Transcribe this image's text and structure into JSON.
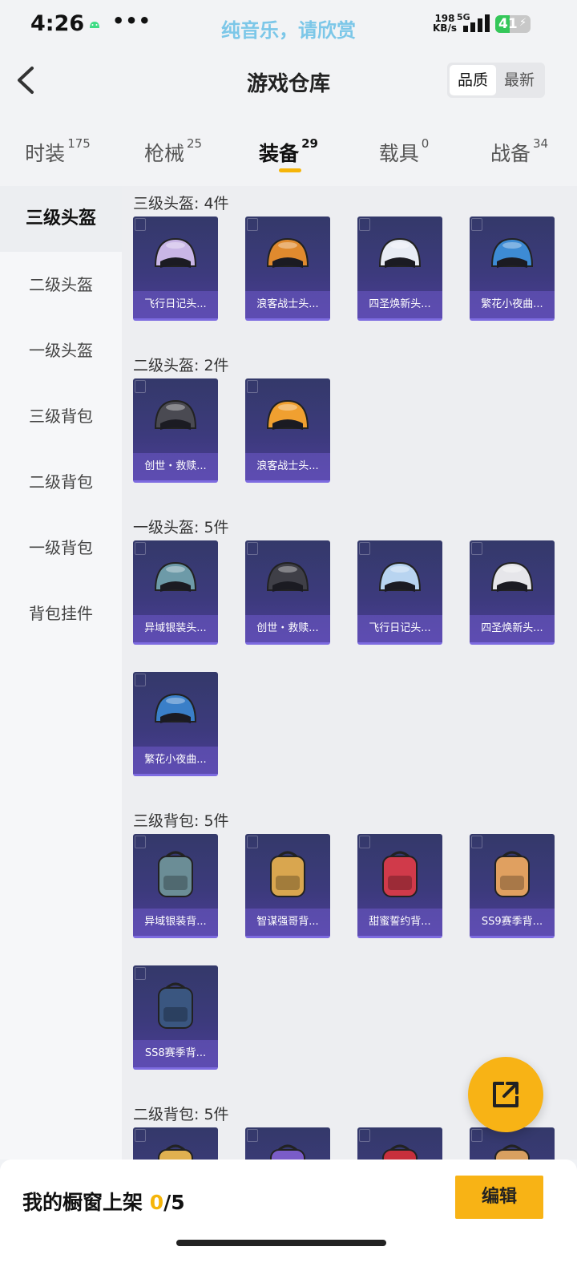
{
  "status_bar": {
    "time": "4:26",
    "marquee": "纯音乐，请欣赏",
    "net_speed_value": "198",
    "net_speed_unit": "KB/s",
    "network": "5G",
    "battery": "41",
    "battery_level": 0.41
  },
  "header": {
    "title": "游戏仓库",
    "sort_options": [
      "品质",
      "最新"
    ],
    "sort_selected": "品质"
  },
  "tabs": [
    {
      "label": "时装",
      "count": "175"
    },
    {
      "label": "枪械",
      "count": "25"
    },
    {
      "label": "装备",
      "count": "29",
      "active": true
    },
    {
      "label": "载具",
      "count": "0"
    },
    {
      "label": "战备",
      "count": "34"
    }
  ],
  "sidebar": {
    "items": [
      "三级头盔",
      "二级头盔",
      "一级头盔",
      "三级背包",
      "二级背包",
      "一级背包",
      "背包挂件"
    ],
    "active": "三级头盔"
  },
  "groups": [
    {
      "title": "三级头盔: 4件",
      "items": [
        {
          "name": "飞行日记头...",
          "icon": "helmet-icon",
          "color": "#c9b6e6"
        },
        {
          "name": "浪客战士头...",
          "icon": "helmet-icon",
          "color": "#e08a2e"
        },
        {
          "name": "四圣焕新头...",
          "icon": "helmet-icon",
          "color": "#e8ecf4"
        },
        {
          "name": "繁花小夜曲...",
          "icon": "helmet-icon",
          "color": "#3d8bd4"
        }
      ]
    },
    {
      "title": "二级头盔: 2件",
      "items": [
        {
          "name": "创世・救赎...",
          "icon": "helmet-icon",
          "color": "#4a4a52"
        },
        {
          "name": "浪客战士头...",
          "icon": "helmet-icon",
          "color": "#f0a030"
        }
      ]
    },
    {
      "title": "一级头盔: 5件",
      "items": [
        {
          "name": "异域银装头...",
          "icon": "helmet-icon",
          "color": "#6d9aa8"
        },
        {
          "name": "创世・救赎...",
          "icon": "helmet-icon",
          "color": "#3f3f47"
        },
        {
          "name": "飞行日记头...",
          "icon": "helmet-icon",
          "color": "#b8d4f0"
        },
        {
          "name": "四圣焕新头...",
          "icon": "helmet-icon",
          "color": "#e6e6ea"
        },
        {
          "name": "繁花小夜曲...",
          "icon": "helmet-icon",
          "color": "#3a7fc8"
        }
      ]
    },
    {
      "title": "三级背包: 5件",
      "items": [
        {
          "name": "异域银装背...",
          "icon": "backpack-icon",
          "color": "#6b8d96"
        },
        {
          "name": "智谋强哥背...",
          "icon": "backpack-icon",
          "color": "#d9a64f"
        },
        {
          "name": "甜蜜誓约背...",
          "icon": "backpack-icon",
          "color": "#d03a4a"
        },
        {
          "name": "SS9赛季背...",
          "icon": "backpack-icon",
          "color": "#e0a060"
        },
        {
          "name": "SS8赛季背...",
          "icon": "backpack-icon",
          "color": "#3a5680"
        }
      ]
    },
    {
      "title": "二级背包: 5件",
      "items": [
        {
          "name": "",
          "icon": "backpack-icon",
          "color": "#e0b050"
        },
        {
          "name": "",
          "icon": "backpack-icon",
          "color": "#7a5cc8"
        },
        {
          "name": "",
          "icon": "backpack-icon",
          "color": "#c8303c"
        },
        {
          "name": "",
          "icon": "backpack-icon",
          "color": "#d8a060"
        }
      ]
    }
  ],
  "bottom": {
    "shelf_label": "我的橱窗上架",
    "shelf_current": "0",
    "shelf_total": "/5",
    "edit_label": "编辑"
  },
  "fab": {
    "icon": "share-icon"
  }
}
